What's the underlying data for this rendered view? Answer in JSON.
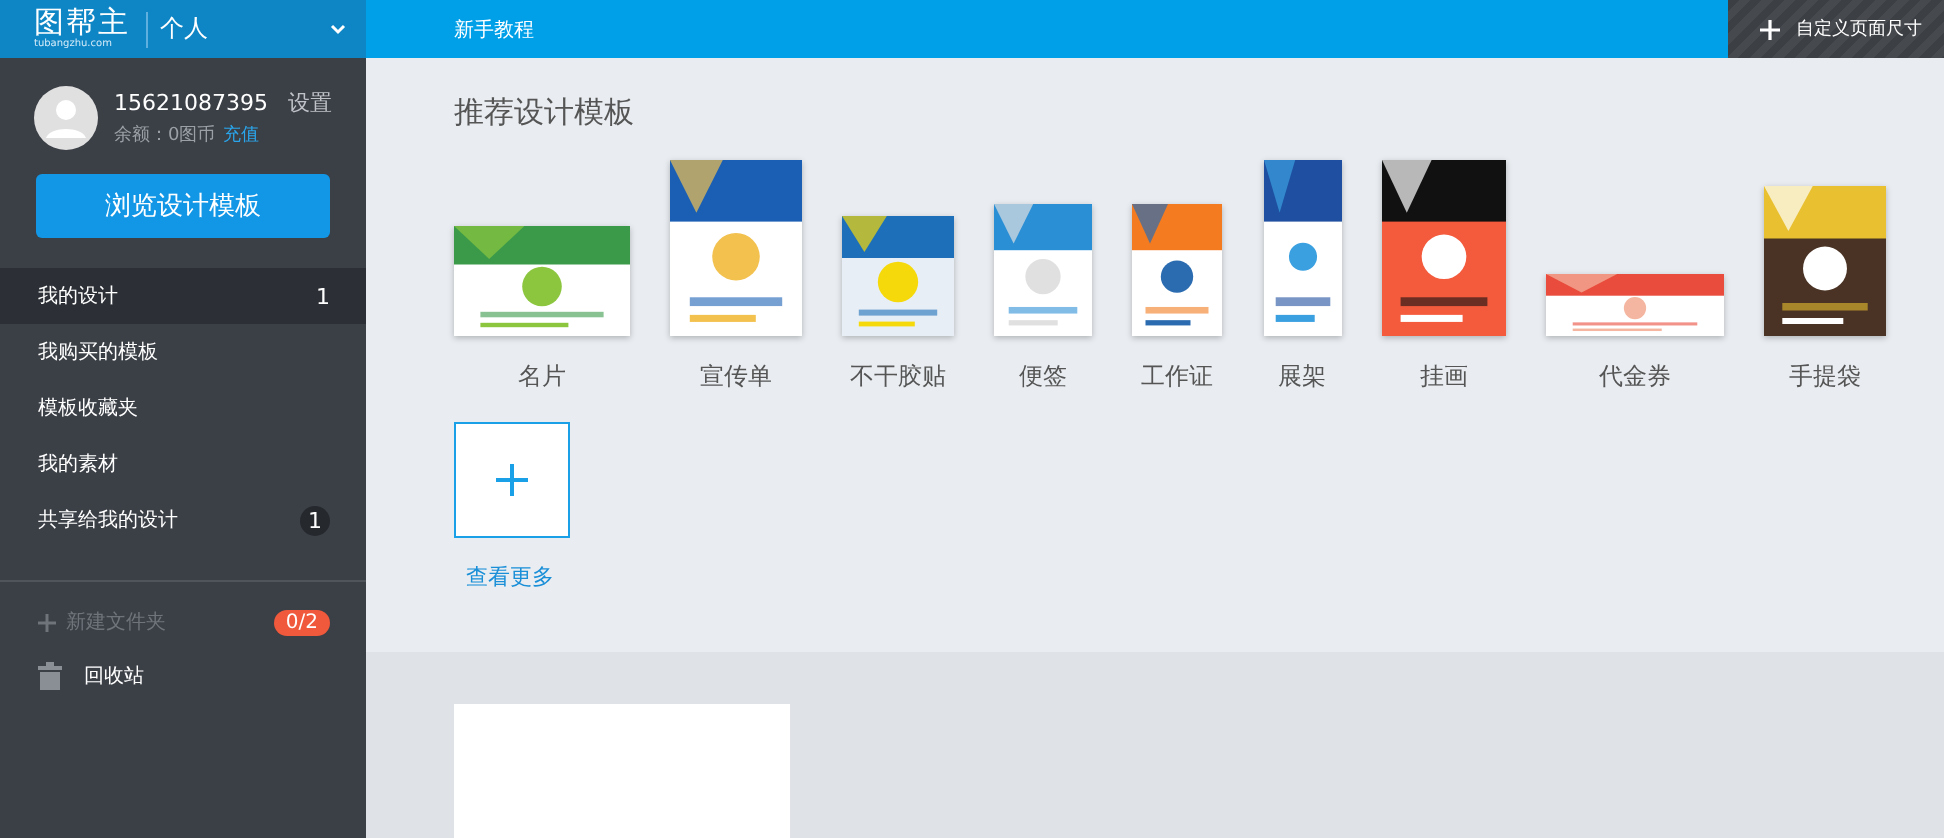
{
  "header": {
    "logo": "图帮主",
    "logo_sub": "tubangzhu.com",
    "account": "个人",
    "nav_link": "新手教程",
    "custom_size_button": "自定义页面尺寸"
  },
  "user": {
    "phone": "15621087395",
    "settings": "设置",
    "balance": "余额：0图币",
    "recharge": "充值"
  },
  "browse_button": "浏览设计模板",
  "menu": [
    {
      "label": "我的设计",
      "count": "1",
      "selected": true
    },
    {
      "label": "我购买的模板",
      "selected": false
    },
    {
      "label": "模板收藏夹",
      "selected": false
    },
    {
      "label": "我的素材",
      "selected": false
    },
    {
      "label": "共享给我的设计",
      "count": "1",
      "selected": false
    }
  ],
  "new_folder": {
    "label": "新建文件夹",
    "count": "0/2",
    "disabled": true
  },
  "trash": "回收站",
  "section_title": "推荐设计模板",
  "templates": [
    {
      "label": "名片"
    },
    {
      "label": "宣传单"
    },
    {
      "label": "不干胶贴"
    },
    {
      "label": "便签"
    },
    {
      "label": "工作证"
    },
    {
      "label": "展架"
    },
    {
      "label": "挂画"
    },
    {
      "label": "代金券"
    },
    {
      "label": "手提袋"
    }
  ],
  "more": "查看更多"
}
